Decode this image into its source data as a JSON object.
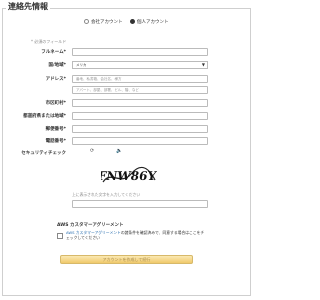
{
  "section_title": "連絡先情報",
  "account_type": {
    "options": [
      "会社アカウント",
      "個人アカウント"
    ],
    "selected": "個人アカウント"
  },
  "required_note": "* 必須のフィールド",
  "fields": {
    "full_name": {
      "label": "フルネーム*",
      "value": ""
    },
    "country": {
      "label": "国/地域*",
      "value": "メリカ"
    },
    "address": {
      "label": "アドレス*",
      "line1_placeholder": "番地、私書箱、会社名、様方",
      "line2_placeholder": "アパート、部屋、部署、ビル、階、など"
    },
    "city": {
      "label": "市区町村*",
      "value": ""
    },
    "prefecture": {
      "label": "都道府県または地域*",
      "value": ""
    },
    "postal_code": {
      "label": "郵便番号*",
      "value": ""
    },
    "phone": {
      "label": "電話番号*",
      "value": ""
    }
  },
  "security": {
    "label": "セキュリティチェック",
    "captcha_text": "FNW86Y",
    "instruction": "上に表示された文字を入力してください",
    "input_value": ""
  },
  "agreement": {
    "title": "AWS カスタマーアグリーメント",
    "text_link": "AWS カスタマーアグリーメント",
    "text_rest": "の諸条件を確認済みで、同意する場合はここをチェックしてください"
  },
  "submit_label": "アカウントを作成して続行"
}
